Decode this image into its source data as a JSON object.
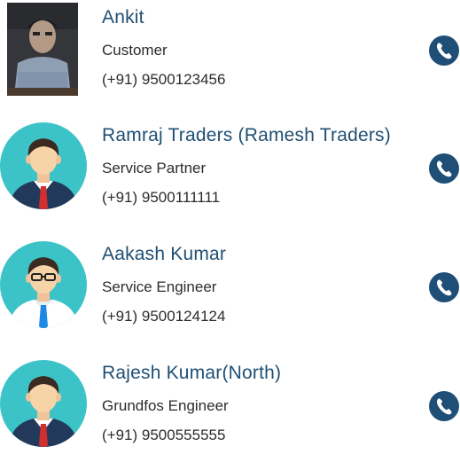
{
  "contacts": [
    {
      "name": "Ankit",
      "role": "Customer",
      "phone": "(+91) 9500123456",
      "avatar_type": "photo"
    },
    {
      "name": "Ramraj Traders (Ramesh Traders)",
      "role": "Service Partner",
      "phone": "(+91) 9500111111",
      "avatar_type": "businessman-red-tie"
    },
    {
      "name": "Aakash Kumar",
      "role": "Service Engineer",
      "phone": "(+91) 9500124124",
      "avatar_type": "engineer-glasses-blue-tie"
    },
    {
      "name": "Rajesh Kumar(North)",
      "role": "Grundfos Engineer",
      "phone": "(+91) 9500555555",
      "avatar_type": "businessman-red-tie"
    }
  ],
  "icons": {
    "call": "phone-icon"
  },
  "colors": {
    "name_text": "#1f4f74",
    "call_button": "#1f4e77",
    "avatar_bg": "#3cc3c8"
  }
}
